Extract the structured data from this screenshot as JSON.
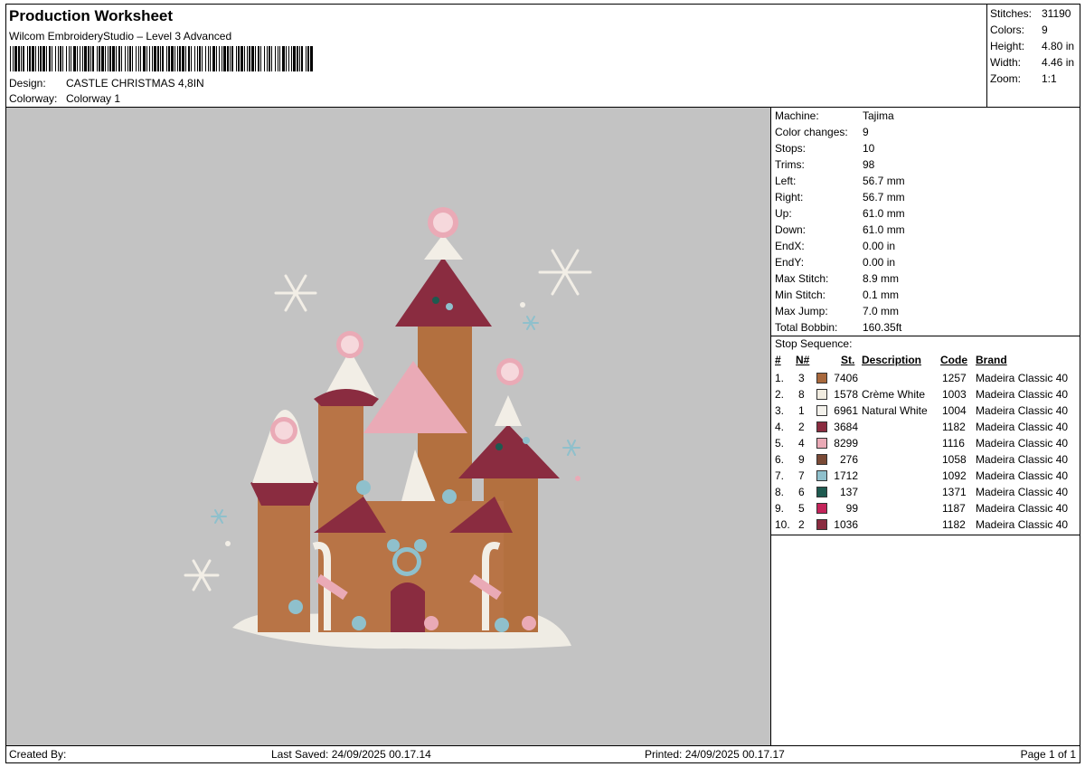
{
  "header": {
    "title": "Production Worksheet",
    "software": "Wilcom EmbroideryStudio – Level 3 Advanced",
    "barcode_label": "barcode",
    "design_label": "Design:",
    "design_value": "CASTLE CHRISTMAS 4,8IN",
    "colorway_label": "Colorway:",
    "colorway_value": "Colorway 1"
  },
  "summary": [
    {
      "label": "Stitches:",
      "value": "31190"
    },
    {
      "label": "Colors:",
      "value": "9"
    },
    {
      "label": "Height:",
      "value": "4.80 in"
    },
    {
      "label": "Width:",
      "value": "4.46 in"
    },
    {
      "label": "Zoom:",
      "value": "1:1"
    }
  ],
  "machine_info": [
    {
      "label": "Machine:",
      "value": "Tajima"
    },
    {
      "label": "Color changes:",
      "value": "9"
    },
    {
      "label": "Stops:",
      "value": "10"
    },
    {
      "label": "Trims:",
      "value": "98"
    },
    {
      "label": "Left:",
      "value": "56.7 mm"
    },
    {
      "label": "Right:",
      "value": "56.7 mm"
    },
    {
      "label": "Up:",
      "value": "61.0 mm"
    },
    {
      "label": "Down:",
      "value": "61.0 mm"
    },
    {
      "label": "EndX:",
      "value": "0.00 in"
    },
    {
      "label": "EndY:",
      "value": "0.00 in"
    },
    {
      "label": "Max Stitch:",
      "value": "8.9 mm"
    },
    {
      "label": "Min Stitch:",
      "value": "0.1 mm"
    },
    {
      "label": "Max Jump:",
      "value": "7.0 mm"
    },
    {
      "label": "Total Bobbin:",
      "value": "160.35ft"
    }
  ],
  "stop_sequence": {
    "title": "Stop Sequence:",
    "headers": {
      "num": "#",
      "n": "N#",
      "st": "St.",
      "description": "Description",
      "code": "Code",
      "brand": "Brand"
    },
    "rows": [
      {
        "num": "1.",
        "n": "3",
        "color": "#a8683c",
        "st": "7406",
        "description": "",
        "code": "1257",
        "brand": "Madeira Classic 40"
      },
      {
        "num": "2.",
        "n": "8",
        "color": "#f1ece0",
        "st": "1578",
        "description": "Crème White",
        "code": "1003",
        "brand": "Madeira Classic 40"
      },
      {
        "num": "3.",
        "n": "1",
        "color": "#f4f2ec",
        "st": "6961",
        "description": "Natural White",
        "code": "1004",
        "brand": "Madeira Classic 40"
      },
      {
        "num": "4.",
        "n": "2",
        "color": "#8a2c40",
        "st": "3684",
        "description": "",
        "code": "1182",
        "brand": "Madeira Classic 40"
      },
      {
        "num": "5.",
        "n": "4",
        "color": "#eaaab6",
        "st": "8299",
        "description": "",
        "code": "1116",
        "brand": "Madeira Classic 40"
      },
      {
        "num": "6.",
        "n": "9",
        "color": "#7a4a36",
        "st": "276",
        "description": "",
        "code": "1058",
        "brand": "Madeira Classic 40"
      },
      {
        "num": "7.",
        "n": "7",
        "color": "#8fc0cc",
        "st": "1712",
        "description": "",
        "code": "1092",
        "brand": "Madeira Classic 40"
      },
      {
        "num": "8.",
        "n": "6",
        "color": "#1e5a50",
        "st": "137",
        "description": "",
        "code": "1371",
        "brand": "Madeira Classic 40"
      },
      {
        "num": "9.",
        "n": "5",
        "color": "#c4245a",
        "st": "99",
        "description": "",
        "code": "1187",
        "brand": "Madeira Classic 40"
      },
      {
        "num": "10.",
        "n": "2",
        "color": "#8a2c40",
        "st": "1036",
        "description": "",
        "code": "1182",
        "brand": "Madeira Classic 40"
      }
    ]
  },
  "footer": {
    "created_by": "Created By:",
    "last_saved": "Last Saved: 24/09/2025 00.17.14",
    "printed": "Printed: 24/09/2025 00.17.17",
    "page": "Page 1 of 1"
  }
}
